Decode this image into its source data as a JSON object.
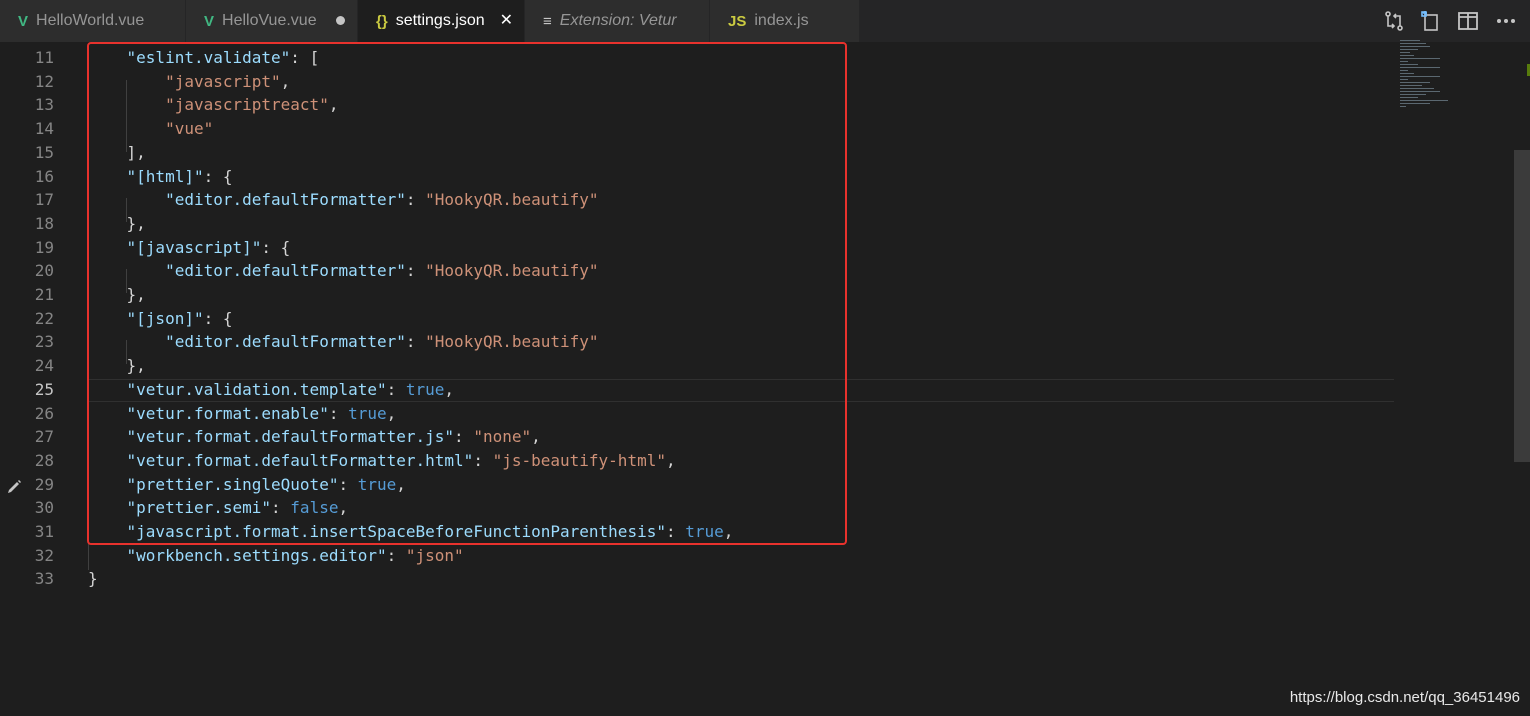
{
  "tabs": [
    {
      "icon": "V",
      "icon_color": "#41b883",
      "label": "HelloWorld.vue",
      "italic": false,
      "active": false
    },
    {
      "icon": "V",
      "icon_color": "#41b883",
      "label": "HelloVue.vue",
      "italic": false,
      "active": false,
      "dirty": true
    },
    {
      "icon": "{}",
      "icon_color": "#cbcb41",
      "label": "settings.json",
      "italic": false,
      "active": true
    },
    {
      "icon": "≡",
      "icon_color": "#c5c5c5",
      "label": "Extension: Vetur",
      "italic": true,
      "active": false
    },
    {
      "icon": "JS",
      "icon_color": "#cbcb41",
      "label": "index.js",
      "italic": false,
      "active": false
    }
  ],
  "close_glyph": "✕",
  "actions": [
    "compare-changes-icon",
    "open-preview-icon",
    "split-editor-icon",
    "more-actions-icon"
  ],
  "lines": [
    {
      "n": "11",
      "t": [
        [
          "k",
          "    \"eslint.validate\""
        ],
        [
          "p",
          ": ["
        ]
      ]
    },
    {
      "n": "12",
      "t": [
        [
          "s",
          "        \"javascript\""
        ],
        [
          "p",
          ","
        ]
      ]
    },
    {
      "n": "13",
      "t": [
        [
          "s",
          "        \"javascriptreact\""
        ],
        [
          "p",
          ","
        ]
      ]
    },
    {
      "n": "14",
      "t": [
        [
          "s",
          "        \"vue\""
        ]
      ]
    },
    {
      "n": "15",
      "t": [
        [
          "p",
          "    ],"
        ]
      ]
    },
    {
      "n": "16",
      "t": [
        [
          "k",
          "    \"[html]\""
        ],
        [
          "p",
          ": {"
        ]
      ]
    },
    {
      "n": "17",
      "t": [
        [
          "k",
          "        \"editor.defaultFormatter\""
        ],
        [
          "p",
          ": "
        ],
        [
          "s",
          "\"HookyQR.beautify\""
        ]
      ]
    },
    {
      "n": "18",
      "t": [
        [
          "p",
          "    },"
        ]
      ]
    },
    {
      "n": "19",
      "t": [
        [
          "k",
          "    \"[javascript]\""
        ],
        [
          "p",
          ": {"
        ]
      ]
    },
    {
      "n": "20",
      "t": [
        [
          "k",
          "        \"editor.defaultFormatter\""
        ],
        [
          "p",
          ": "
        ],
        [
          "s",
          "\"HookyQR.beautify\""
        ]
      ]
    },
    {
      "n": "21",
      "t": [
        [
          "p",
          "    },"
        ]
      ]
    },
    {
      "n": "22",
      "t": [
        [
          "k",
          "    \"[json]\""
        ],
        [
          "p",
          ": {"
        ]
      ]
    },
    {
      "n": "23",
      "t": [
        [
          "k",
          "        \"editor.defaultFormatter\""
        ],
        [
          "p",
          ": "
        ],
        [
          "s",
          "\"HookyQR.beautify\""
        ]
      ]
    },
    {
      "n": "24",
      "t": [
        [
          "p",
          "    },"
        ]
      ]
    },
    {
      "n": "25",
      "t": [
        [
          "k",
          "    \"vetur.validation.template\""
        ],
        [
          "p",
          ": "
        ],
        [
          "b",
          "true"
        ],
        [
          "p",
          ","
        ]
      ]
    },
    {
      "n": "26",
      "t": [
        [
          "k",
          "    \"vetur.format.enable\""
        ],
        [
          "p",
          ": "
        ],
        [
          "b",
          "true"
        ],
        [
          "p",
          ","
        ]
      ]
    },
    {
      "n": "27",
      "t": [
        [
          "k",
          "    \"vetur.format.defaultFormatter.js\""
        ],
        [
          "p",
          ": "
        ],
        [
          "s",
          "\"none\""
        ],
        [
          "p",
          ","
        ]
      ]
    },
    {
      "n": "28",
      "t": [
        [
          "k",
          "    \"vetur.format.defaultFormatter.html\""
        ],
        [
          "p",
          ": "
        ],
        [
          "s",
          "\"js-beautify-html\""
        ],
        [
          "p",
          ","
        ]
      ]
    },
    {
      "n": "29",
      "t": [
        [
          "k",
          "    \"prettier.singleQuote\""
        ],
        [
          "p",
          ": "
        ],
        [
          "b",
          "true"
        ],
        [
          "p",
          ","
        ]
      ]
    },
    {
      "n": "30",
      "t": [
        [
          "k",
          "    \"prettier.semi\""
        ],
        [
          "p",
          ": "
        ],
        [
          "b",
          "false"
        ],
        [
          "p",
          ","
        ]
      ]
    },
    {
      "n": "31",
      "t": [
        [
          "k",
          "    \"javascript.format.insertSpaceBeforeFunctionParenthesis\""
        ],
        [
          "p",
          ": "
        ],
        [
          "b",
          "true"
        ],
        [
          "p",
          ","
        ]
      ]
    },
    {
      "n": "32",
      "t": [
        [
          "k",
          "    \"workbench.settings.editor\""
        ],
        [
          "p",
          ": "
        ],
        [
          "s",
          "\"json\""
        ]
      ]
    },
    {
      "n": "33",
      "t": [
        [
          "p",
          "}"
        ]
      ]
    }
  ],
  "current_line": "25",
  "watermark": "https://blog.csdn.net/qq_36451496",
  "colors": {
    "highlight_box": "#e8322d",
    "vue_icon": "#41b883",
    "json_icon": "#cbcb41"
  }
}
